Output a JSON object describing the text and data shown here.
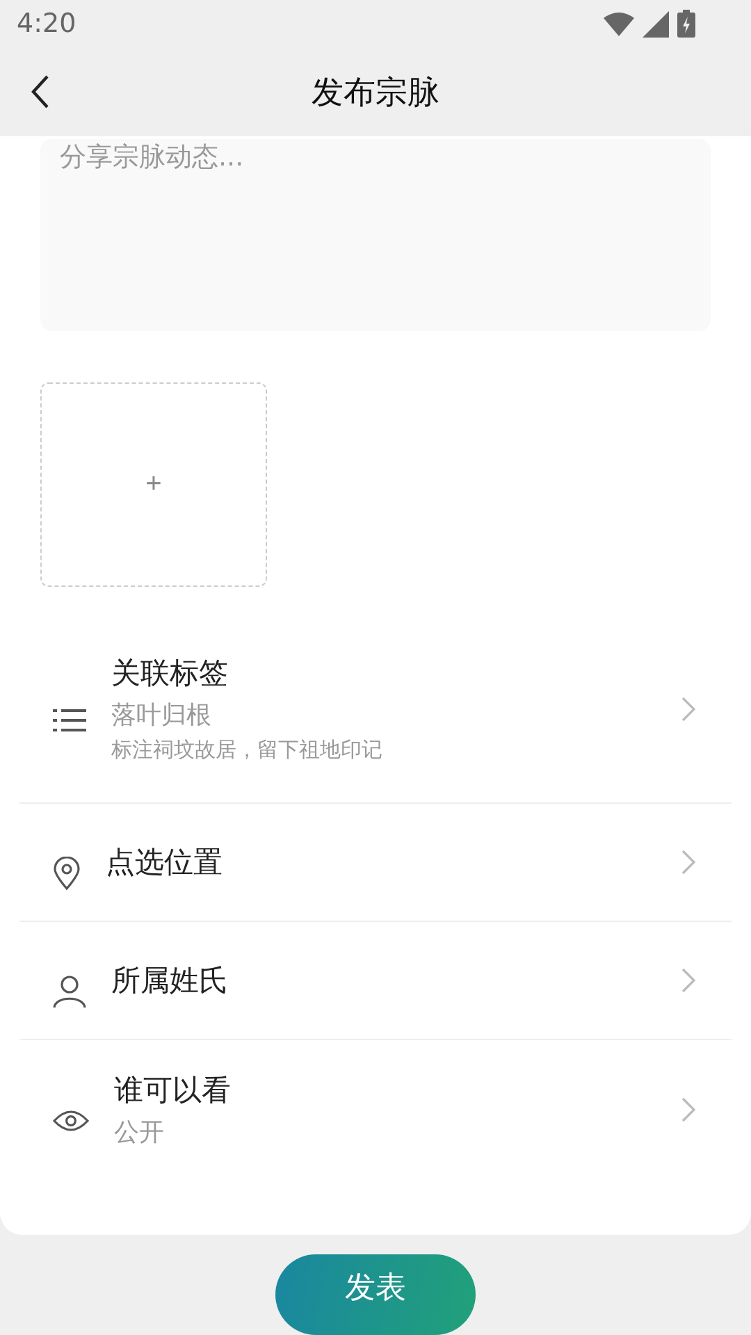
{
  "status_bar": {
    "time": "4:20"
  },
  "header": {
    "title": "发布宗脉"
  },
  "post": {
    "placeholder": "分享宗脉动态...",
    "add_photo": "+"
  },
  "options": [
    {
      "title": "关联标签",
      "value": "落叶归根",
      "hint": "标注祠坟故居，留下祖地印记"
    },
    {
      "title": "点选位置"
    },
    {
      "title": "所属姓氏"
    },
    {
      "title": "谁可以看",
      "value": "公开"
    }
  ],
  "submit": "发表"
}
